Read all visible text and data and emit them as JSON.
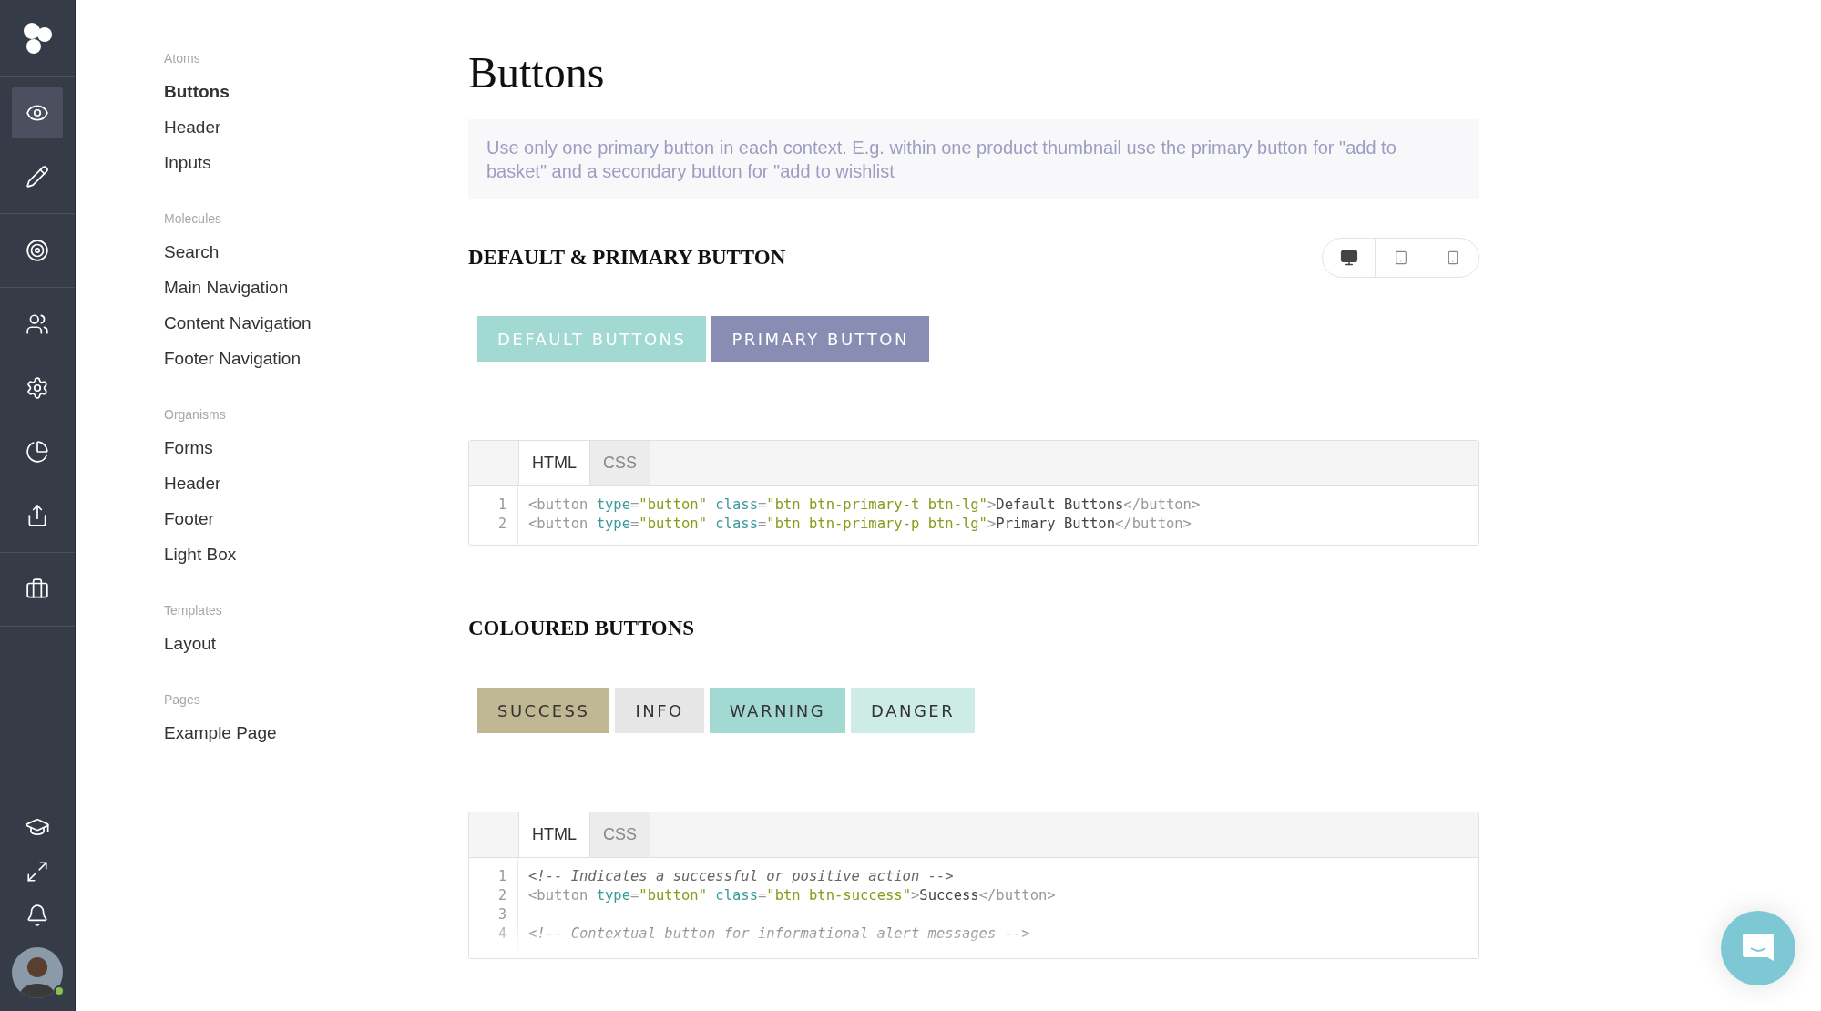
{
  "rail": {
    "items": [
      {
        "selected": true
      },
      {
        "selected": false
      },
      {
        "selected": false
      },
      {
        "selected": false
      },
      {
        "selected": false
      },
      {
        "selected": false
      },
      {
        "selected": false
      },
      {
        "selected": false
      }
    ],
    "avatar": {
      "online": true
    }
  },
  "nav": {
    "groups": [
      {
        "label": "Atoms",
        "items": [
          {
            "label": "Buttons",
            "selected": true
          },
          {
            "label": "Header",
            "selected": false
          },
          {
            "label": "Inputs",
            "selected": false
          }
        ]
      },
      {
        "label": "Molecules",
        "items": [
          {
            "label": "Search",
            "selected": false
          },
          {
            "label": "Main Navigation",
            "selected": false
          },
          {
            "label": "Content Navigation",
            "selected": false
          },
          {
            "label": "Footer Navigation",
            "selected": false
          }
        ]
      },
      {
        "label": "Organisms",
        "items": [
          {
            "label": "Forms",
            "selected": false
          },
          {
            "label": "Header",
            "selected": false
          },
          {
            "label": "Footer",
            "selected": false
          },
          {
            "label": "Light Box",
            "selected": false
          }
        ]
      },
      {
        "label": "Templates",
        "items": [
          {
            "label": "Layout",
            "selected": false
          }
        ]
      },
      {
        "label": "Pages",
        "items": [
          {
            "label": "Example Page",
            "selected": false
          }
        ]
      }
    ]
  },
  "page": {
    "title": "Buttons",
    "note": "Use only one primary button in each context. E.g. within one product thumbnail use the primary button for \"add to basket\" and a secondary button for \"add to wishlist"
  },
  "sections": [
    {
      "heading": "DEFAULT & PRIMARY BUTTON",
      "devices": [
        {
          "selected": true
        },
        {
          "selected": false
        },
        {
          "selected": false
        }
      ],
      "buttons": [
        {
          "label": "DEFAULT BUTTONS",
          "kind": "default"
        },
        {
          "label": "PRIMARY BUTTON",
          "kind": "primary"
        }
      ],
      "code": {
        "tabs": [
          {
            "label": "HTML",
            "selected": true
          },
          {
            "label": "CSS",
            "selected": false
          }
        ],
        "lines": [
          {
            "number": "1",
            "tokens": [
              {
                "kind": "tag",
                "text": "<button "
              },
              {
                "kind": "attr",
                "text": "type"
              },
              {
                "kind": "tag",
                "text": "="
              },
              {
                "kind": "str",
                "text": "\"button\""
              },
              {
                "kind": "attr",
                "text": " class"
              },
              {
                "kind": "tag",
                "text": "="
              },
              {
                "kind": "str",
                "text": "\"btn btn-primary-t btn-lg\""
              },
              {
                "kind": "tag",
                "text": ">"
              },
              {
                "kind": "text",
                "text": "Default Buttons"
              },
              {
                "kind": "tag",
                "text": "</button>"
              }
            ]
          },
          {
            "number": "2",
            "tokens": [
              {
                "kind": "tag",
                "text": "<button "
              },
              {
                "kind": "attr",
                "text": "type"
              },
              {
                "kind": "tag",
                "text": "="
              },
              {
                "kind": "str",
                "text": "\"button\""
              },
              {
                "kind": "attr",
                "text": " class"
              },
              {
                "kind": "tag",
                "text": "="
              },
              {
                "kind": "str",
                "text": "\"btn btn-primary-p btn-lg\""
              },
              {
                "kind": "tag",
                "text": ">"
              },
              {
                "kind": "text",
                "text": "Primary Button"
              },
              {
                "kind": "tag",
                "text": "</button>"
              }
            ]
          }
        ]
      }
    },
    {
      "heading": "COLOURED BUTTONS",
      "buttons": [
        {
          "label": "SUCCESS",
          "kind": "success"
        },
        {
          "label": "INFO",
          "kind": "info"
        },
        {
          "label": "WARNING",
          "kind": "warning"
        },
        {
          "label": "DANGER",
          "kind": "danger"
        }
      ],
      "code": {
        "tabs": [
          {
            "label": "HTML",
            "selected": true
          },
          {
            "label": "CSS",
            "selected": false
          }
        ],
        "lines": [
          {
            "number": "1",
            "tokens": [
              {
                "kind": "comment",
                "text": "<!-- Indicates a successful or positive action -->"
              }
            ]
          },
          {
            "number": "2",
            "tokens": [
              {
                "kind": "tag",
                "text": "<button "
              },
              {
                "kind": "attr",
                "text": "type"
              },
              {
                "kind": "tag",
                "text": "="
              },
              {
                "kind": "str",
                "text": "\"button\""
              },
              {
                "kind": "attr",
                "text": " class"
              },
              {
                "kind": "tag",
                "text": "="
              },
              {
                "kind": "str",
                "text": "\"btn btn-success\""
              },
              {
                "kind": "tag",
                "text": ">"
              },
              {
                "kind": "text",
                "text": "Success"
              },
              {
                "kind": "tag",
                "text": "</button>"
              }
            ]
          },
          {
            "number": "3"
          },
          {
            "number": "4",
            "tokens": [
              {
                "kind": "comment",
                "text": "<!-- Contextual button for informational alert messages -->"
              }
            ]
          }
        ]
      }
    }
  ]
}
